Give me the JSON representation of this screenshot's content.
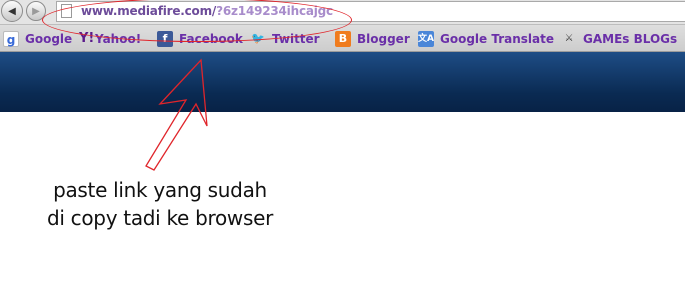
{
  "browser": {
    "url_host": "www.mediafire.com/",
    "url_path": "?6z149234ihcajgc"
  },
  "bookmarks": [
    {
      "label": "Google",
      "icon": "google-icon",
      "glyph": "g"
    },
    {
      "label": "Yahoo!",
      "icon": "yahoo-icon",
      "glyph": "Y!"
    },
    {
      "label": "Facebook",
      "icon": "facebook-icon",
      "glyph": "f"
    },
    {
      "label": "Twitter",
      "icon": "twitter-icon",
      "glyph": "🐦"
    },
    {
      "label": "Blogger",
      "icon": "blogger-icon",
      "glyph": "B"
    },
    {
      "label": "Google Translate",
      "icon": "translate-icon",
      "glyph": "文A"
    },
    {
      "label": "GAMEs BLOGs",
      "icon": "games-icon",
      "glyph": "⚔"
    }
  ],
  "annotation": {
    "line1": "paste link yang sudah",
    "line2": "di copy tadi ke browser",
    "color": "#e0252b"
  },
  "colors": {
    "bookmark_text": "#6a2fa8",
    "header_blue": "#0a2a52"
  }
}
